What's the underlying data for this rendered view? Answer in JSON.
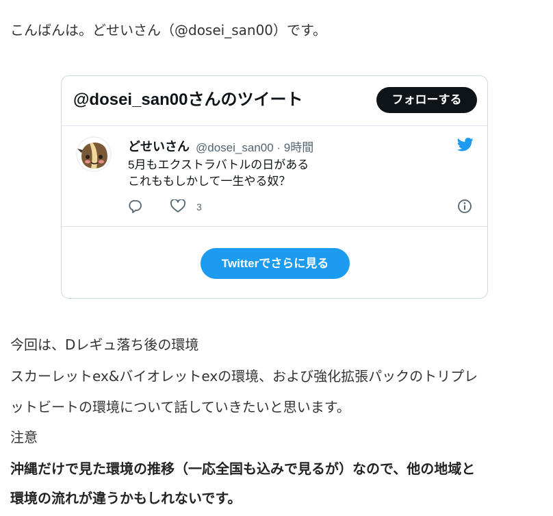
{
  "intro": "こんばんは。どせいさん（@dosei_san00）です。",
  "embed": {
    "title": "@dosei_san00さんのツイート",
    "follow_label": "フォローする",
    "tweet": {
      "author_name": "どせいさん",
      "author_meta": "@dosei_san00 · 9時間",
      "lines": [
        "5月もエクストラバトルの日がある",
        "これももしかして一生やる奴？"
      ],
      "like_count": "3"
    },
    "see_more_label": "Twitterでさらに見る",
    "icons": {
      "reply": "reply-icon",
      "like": "heart-icon",
      "info": "info-icon",
      "brand": "twitter-bird-icon"
    },
    "colors": {
      "accent": "#1d9bf0",
      "dark": "#0f1419",
      "muted": "#536471"
    }
  },
  "body": {
    "line1": "今回は、Dレギュ落ち後の環境",
    "line2": "スカーレットex&バイオレットexの環境、および強化拡張パックのトリプレ",
    "line3": "ットビートの環境について話していきたいと思います。",
    "line4": "注意",
    "bold_line1": "沖縄だけで見た環境の推移（一応全国も込みで見るが）なので、他の地域と",
    "bold_line2": "環境の流れが違うかもしれないです。"
  }
}
